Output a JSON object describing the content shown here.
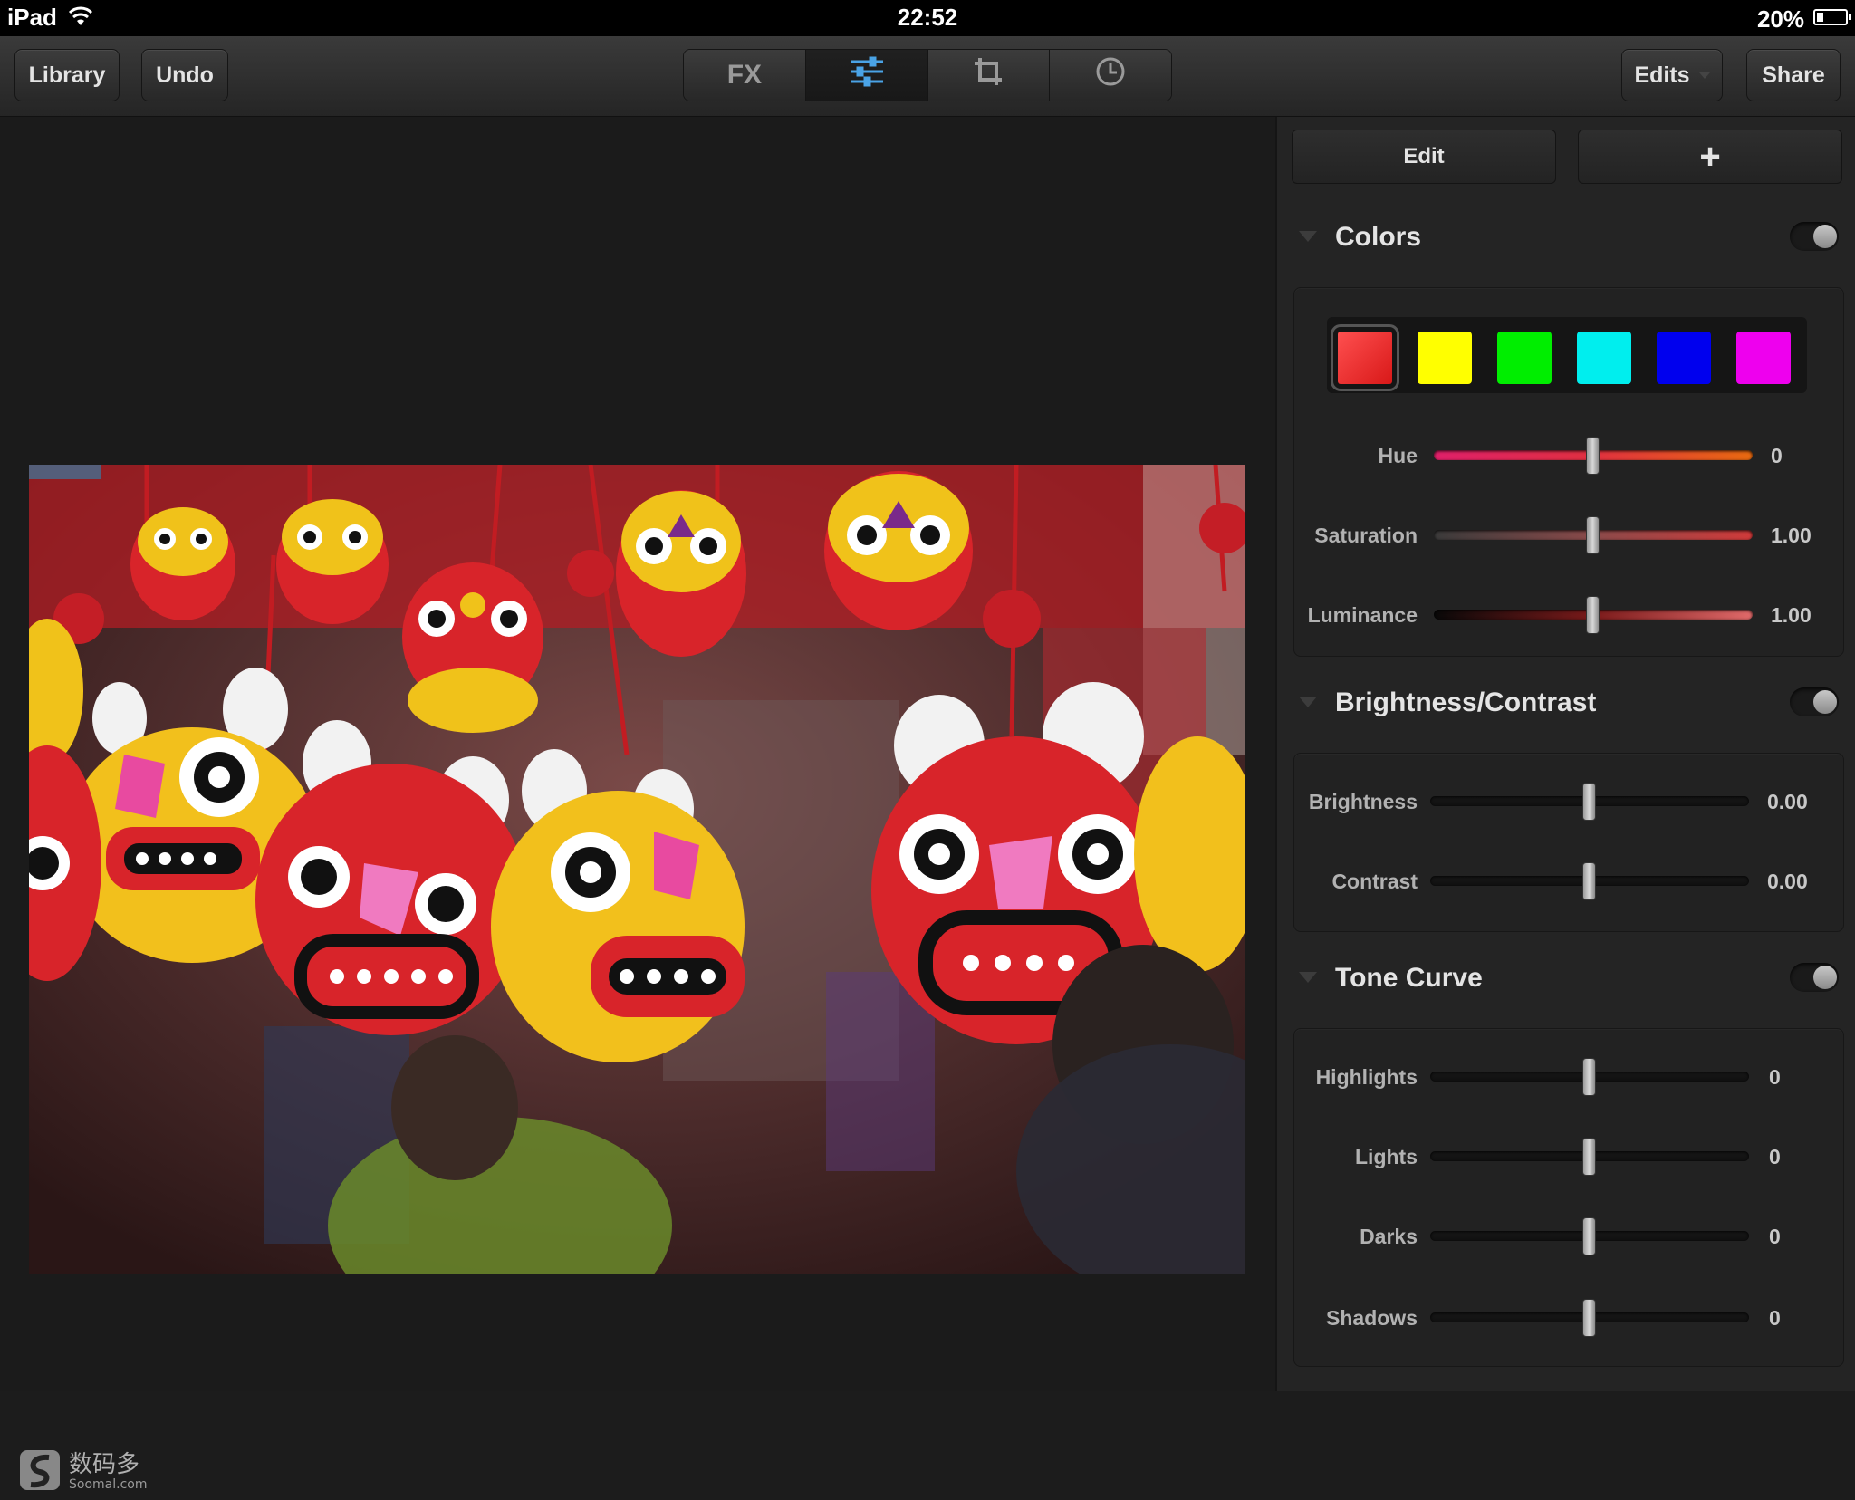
{
  "status_bar": {
    "device": "iPad",
    "time": "22:52",
    "battery": "20%",
    "battery_level": 0.2
  },
  "toolbar": {
    "library_label": "Library",
    "undo_label": "Undo",
    "tabs": [
      {
        "label": "FX",
        "icon": "fx-text",
        "active": false
      },
      {
        "label": "",
        "icon": "sliders-icon",
        "active": true
      },
      {
        "label": "",
        "icon": "crop-icon",
        "active": false
      },
      {
        "label": "",
        "icon": "clock-icon",
        "active": false
      }
    ],
    "edits_label": "Edits",
    "share_label": "Share"
  },
  "colors_accent": {
    "active_tab": "#4aa3e6"
  },
  "panel": {
    "edit_label": "Edit",
    "add_label": "+",
    "sections": {
      "colors": {
        "title": "Colors",
        "enabled": true,
        "swatches": [
          "#e82020",
          "#ffff00",
          "#00ee00",
          "#00eeee",
          "#0000ee",
          "#ee00ee"
        ],
        "selected_swatch": 0,
        "hue": {
          "label": "Hue",
          "value": "0",
          "position": 0.5
        },
        "saturation": {
          "label": "Saturation",
          "value": "1.00",
          "position": 0.5
        },
        "luminance": {
          "label": "Luminance",
          "value": "1.00",
          "position": 0.5
        }
      },
      "brightness_contrast": {
        "title": "Brightness/Contrast",
        "enabled": true,
        "brightness": {
          "label": "Brightness",
          "value": "0.00",
          "position": 0.5
        },
        "contrast": {
          "label": "Contrast",
          "value": "0.00",
          "position": 0.5
        }
      },
      "tone_curve": {
        "title": "Tone Curve",
        "enabled": true,
        "highlights": {
          "label": "Highlights",
          "value": "0",
          "position": 0.5
        },
        "lights": {
          "label": "Lights",
          "value": "0",
          "position": 0.5
        },
        "darks": {
          "label": "Darks",
          "value": "0",
          "position": 0.5
        },
        "shadows": {
          "label": "Shadows",
          "value": "0",
          "position": 0.5
        }
      }
    }
  },
  "watermark": {
    "name": "数码多",
    "url": "Soomal.com"
  }
}
